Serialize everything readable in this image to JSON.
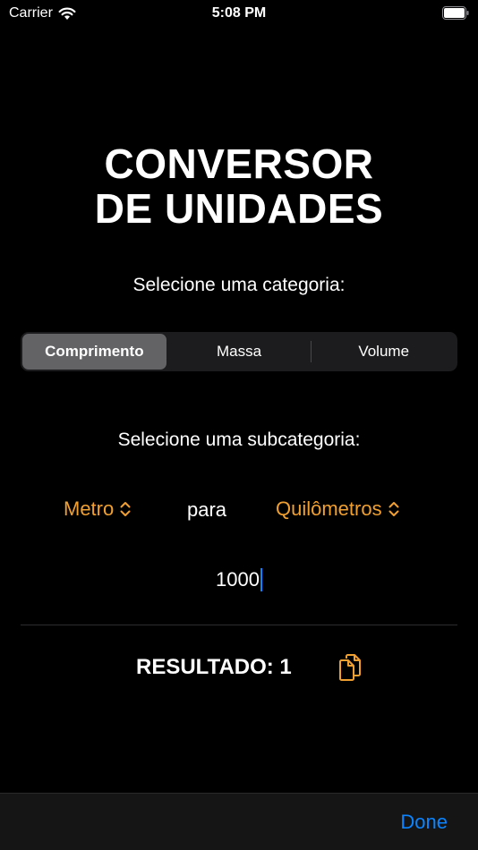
{
  "status_bar": {
    "carrier": "Carrier",
    "time": "5:08 PM"
  },
  "title": {
    "line1": "CONVERSOR",
    "line2": "DE UNIDADES"
  },
  "category": {
    "label": "Selecione uma categoria:",
    "segments": [
      "Comprimento",
      "Massa",
      "Volume"
    ],
    "selected": "Comprimento"
  },
  "subcategory": {
    "label": "Selecione uma subcategoria:",
    "from_unit": "Metro",
    "connector": "para",
    "to_unit": "Quilômetros"
  },
  "input": {
    "value": "1000"
  },
  "result": {
    "text": "RESULTADO: 1"
  },
  "toolbar": {
    "done_label": "Done"
  },
  "colors": {
    "accent": "#f0a030",
    "link": "#0a84ff",
    "background": "#000000"
  },
  "icons": {
    "wifi": "wifi-icon",
    "battery": "battery-icon",
    "chevron_updown": "chevron-up-down-icon",
    "copy": "copy-icon"
  }
}
